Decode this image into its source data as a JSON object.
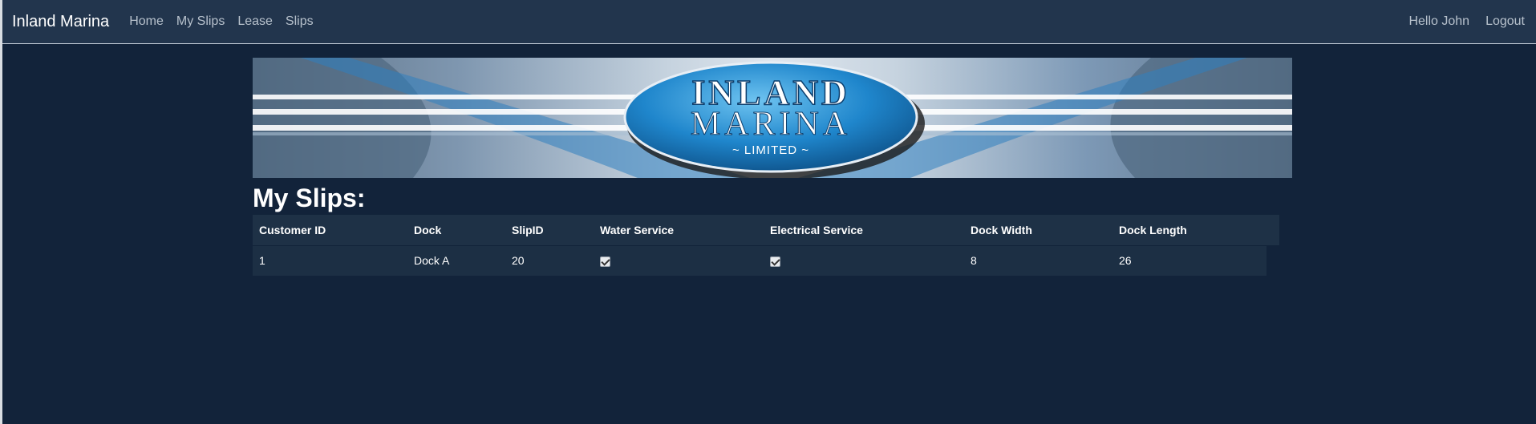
{
  "nav": {
    "brand": "Inland Marina",
    "links": [
      "Home",
      "My Slips",
      "Lease",
      "Slips"
    ],
    "greeting": "Hello John",
    "logout": "Logout"
  },
  "banner": {
    "line1": "INLAND",
    "line2": "MARINA",
    "line3": "~ LIMITED ~"
  },
  "page": {
    "title": "My Slips:"
  },
  "table": {
    "headers": [
      "Customer ID",
      "Dock",
      "SlipID",
      "Water Service",
      "Electrical Service",
      "Dock Width",
      "Dock Length"
    ],
    "rows": [
      {
        "customer_id": "1",
        "dock": "Dock A",
        "slip_id": "20",
        "water_service": true,
        "electrical_service": true,
        "dock_width": "8",
        "dock_length": "26"
      }
    ]
  },
  "colors": {
    "background": "#12233a",
    "navbar": "#22354d",
    "table_header": "#1e3146",
    "table_row": "#1c2f44"
  }
}
